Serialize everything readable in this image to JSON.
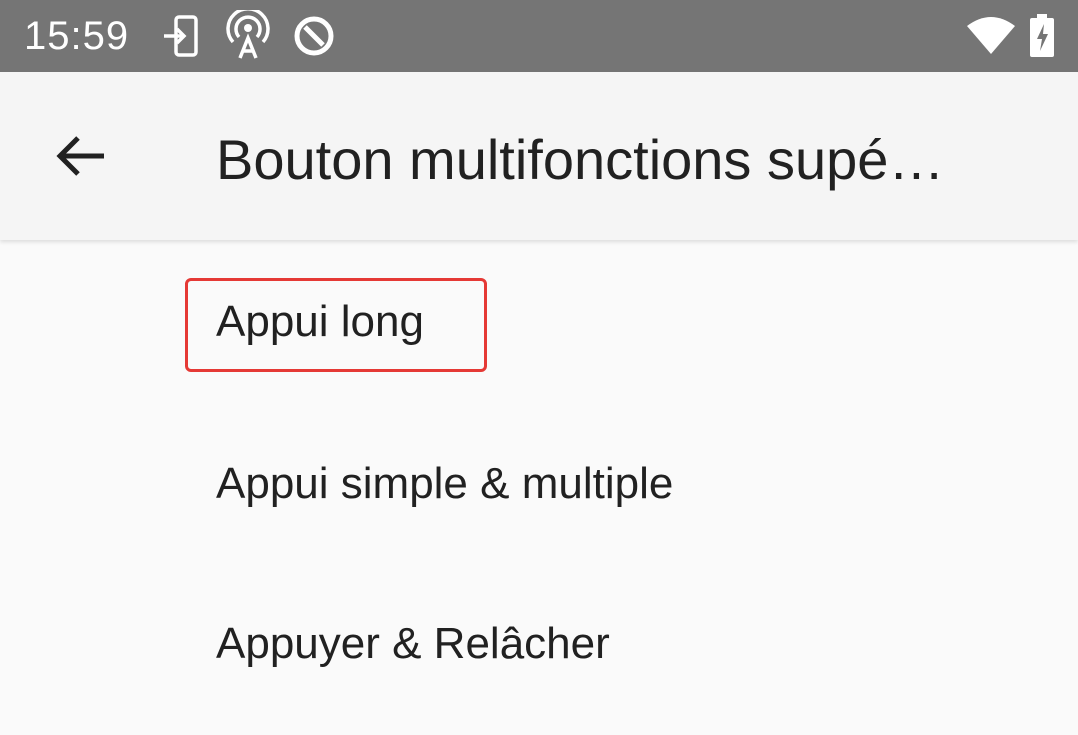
{
  "status_bar": {
    "time": "15:59",
    "left_icons": [
      "sim-transfer-icon",
      "hotspot-icon",
      "no-entry-icon"
    ],
    "right_icons": [
      "wifi-icon",
      "battery-charging-icon"
    ],
    "color": "#757575"
  },
  "app_bar": {
    "back_icon": "back-arrow-icon",
    "title": "Bouton multifonctions supé…"
  },
  "list": {
    "items": [
      {
        "label": "Appui long",
        "highlighted": true
      },
      {
        "label": "Appui simple & multiple",
        "highlighted": false
      },
      {
        "label": "Appuyer & Relâcher",
        "highlighted": false
      }
    ]
  },
  "colors": {
    "highlight": "#e53935",
    "text": "#212121",
    "background": "#fafafa"
  }
}
